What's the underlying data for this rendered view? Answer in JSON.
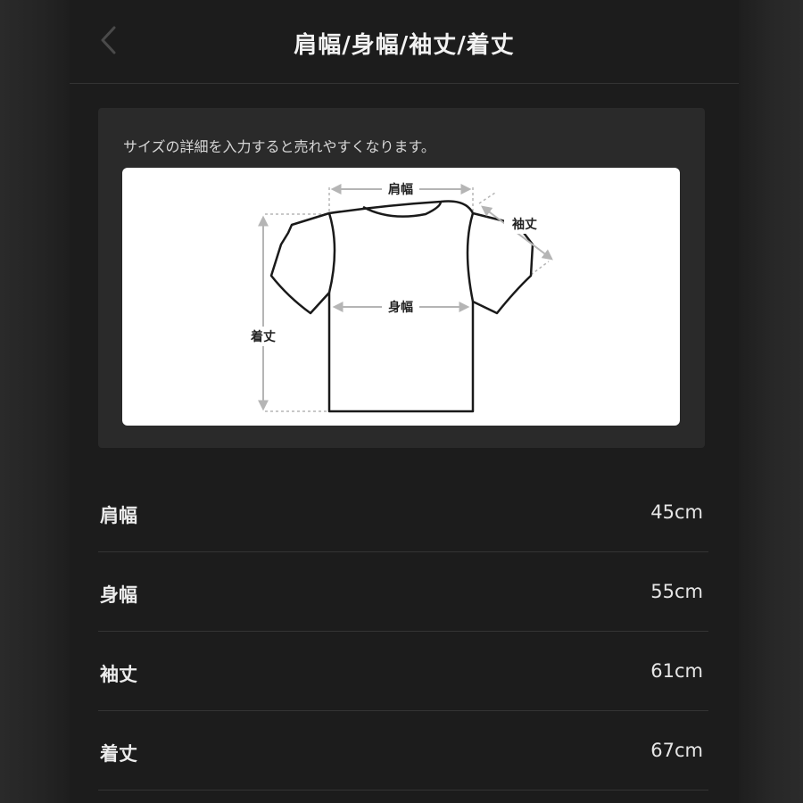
{
  "header": {
    "title": "肩幅/身幅/袖丈/着丈"
  },
  "card": {
    "hint": "サイズの詳細を入力すると売れやすくなります。",
    "diagram": {
      "shoulder_label": "肩幅",
      "width_label": "身幅",
      "sleeve_label": "袖丈",
      "length_label": "着丈"
    }
  },
  "measurements": [
    {
      "label": "肩幅",
      "value": "45cm"
    },
    {
      "label": "身幅",
      "value": "55cm"
    },
    {
      "label": "袖丈",
      "value": "61cm"
    },
    {
      "label": "着丈",
      "value": "67cm"
    }
  ],
  "icons": {
    "back": "chevron-left-icon",
    "diagram": "tshirt-icon"
  },
  "colors": {
    "background": "#1c1c1c",
    "card": "#2a2a2a",
    "text": "#ececec",
    "measure_arrow": "#b5b5b5"
  }
}
